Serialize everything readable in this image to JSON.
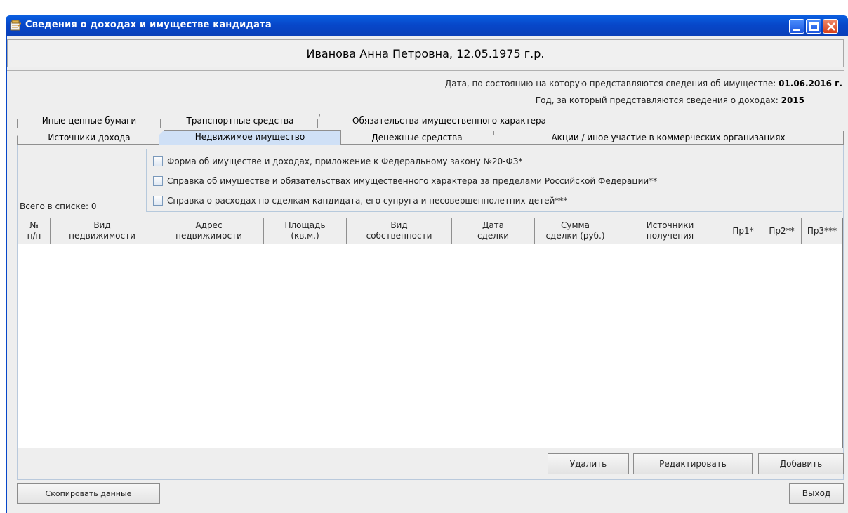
{
  "window": {
    "title": "Сведения о доходах и имуществе кандидата"
  },
  "candidate": {
    "header": "Иванова Анна Петровна, 12.05.1975 г.р."
  },
  "info": {
    "property_date_label": "Дата, по состоянию на которую представляются сведения об имуществе:",
    "property_date_value": "01.06.2016 г.",
    "income_year_label": "Год, за который представляются сведения о доходах:",
    "income_year_value": "2015"
  },
  "tabs": {
    "row_back": [
      {
        "label": "Иные ценные бумаги"
      },
      {
        "label": "Транспортные средства"
      },
      {
        "label": "Обязательства имущественного характера"
      }
    ],
    "row_front": [
      {
        "label": "Источники дохода"
      },
      {
        "label": "Недвижимое имущество",
        "active": true
      },
      {
        "label": "Денежные средства"
      },
      {
        "label": "Акции / иное участие в коммерческих организациях"
      }
    ]
  },
  "documents": [
    {
      "label": "Форма об имуществе и доходах, приложение к Федеральному закону №20-ФЗ*",
      "checked": false
    },
    {
      "label": "Справка об имуществе и обязательствах имущественного характера за пределами Российской Федерации**",
      "checked": false
    },
    {
      "label": "Справка о расходах по сделкам кандидата, его супруга и несовершеннолетних детей***",
      "checked": false
    }
  ],
  "list": {
    "total_label": "Всего в списке: 0",
    "columns": [
      "№\nп/п",
      "Вид\nнедвижимости",
      "Адрес\nнедвижимости",
      "Площадь\n(кв.м.)",
      "Вид\nсобственности",
      "Дата\nсделки",
      "Сумма\nсделки (руб.)",
      "Источники\nполучения",
      "Пр1*",
      "Пр2**",
      "Пр3***"
    ],
    "rows": []
  },
  "actions": {
    "delete": "Удалить",
    "edit": "Редактировать",
    "add": "Добавить",
    "copy": "Скопировать данные",
    "exit": "Выход"
  },
  "colors": {
    "titlebar": "#0747c9",
    "active_tab": "#cfe0f6",
    "panel_bg": "#eeeeee"
  }
}
